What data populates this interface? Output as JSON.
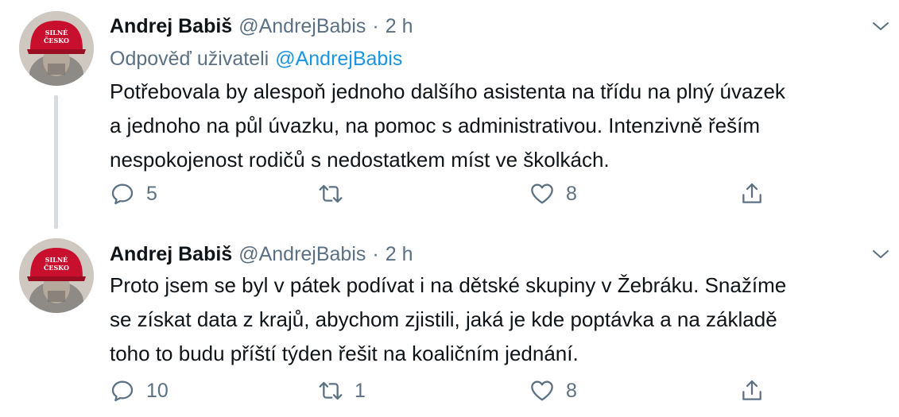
{
  "tweets": [
    {
      "author_name": "Andrej Babiš",
      "handle": "@AndrejBabis",
      "separator": "·",
      "time": "2 h",
      "replying_prefix": "Odpověď uživateli",
      "replying_to": "@AndrejBabis",
      "avatar_cap_text": [
        "SILNÉ",
        "ČESKO"
      ],
      "text": "Potřebovala by alespoň jednoho dalšího asistenta na třídu na plný úvazek\na jednoho na půl úvazku, na pomoc s administrativou. Intenzivně řeším\nnespokojenost rodičů s nedostatkem míst ve školkách.",
      "actions": {
        "reply_count": "5",
        "retweet_count": "",
        "like_count": "8"
      },
      "icons": [
        "reply-icon",
        "retweet-icon",
        "like-icon",
        "share-icon",
        "chevron-down-icon"
      ]
    },
    {
      "author_name": "Andrej Babiš",
      "handle": "@AndrejBabis",
      "separator": "·",
      "time": "2 h",
      "avatar_cap_text": [
        "SILNÉ",
        "ČESKO"
      ],
      "text": "Proto jsem se byl v pátek podívat i na dětské skupiny v Žebráku. Snažíme\nse získat data z krajů, abychom zjistili, jaká je kde poptávka a na základě\ntoho to budu příští týden řešit na koaličním jednání.",
      "actions": {
        "reply_count": "10",
        "retweet_count": "1",
        "like_count": "8"
      },
      "icons": [
        "reply-icon",
        "retweet-icon",
        "like-icon",
        "share-icon",
        "chevron-down-icon"
      ]
    }
  ],
  "colors": {
    "text": "#0f1419",
    "secondary": "#5b7083",
    "link": "#1b95e0",
    "thread_line": "#d7dce1",
    "cap_red": "#c8102e"
  }
}
